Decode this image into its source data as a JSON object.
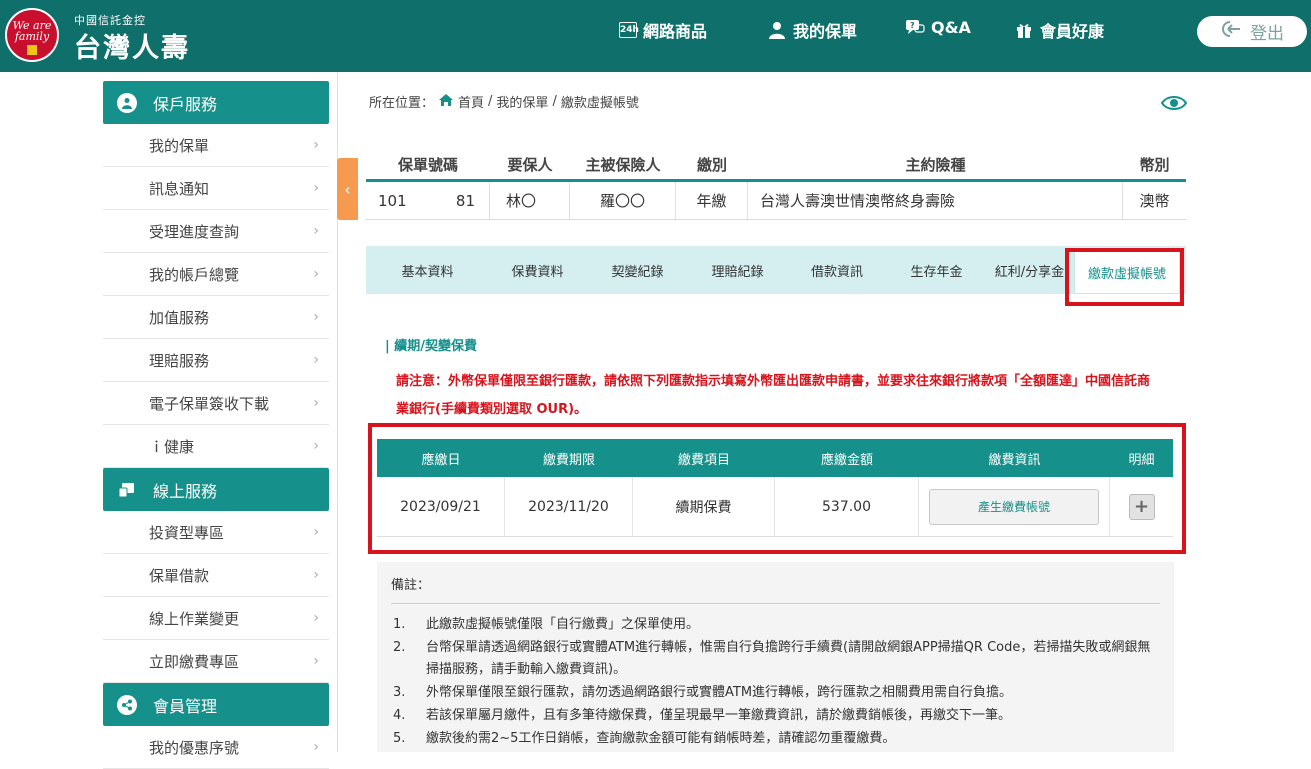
{
  "header": {
    "logo_text": "We are family",
    "brand_small": "中國信託金控",
    "brand_big": "台灣人壽",
    "nav": [
      {
        "icon": "24h-product-icon",
        "glyph": "24h",
        "label": "網路商品"
      },
      {
        "icon": "user-icon",
        "glyph": "👤",
        "label": "我的保單"
      },
      {
        "icon": "qa-icon",
        "glyph": "?",
        "label": "Q&A"
      },
      {
        "icon": "gift-icon",
        "glyph": "🎁",
        "label": "會員好康"
      }
    ],
    "logout_label": "登出"
  },
  "sidebar": {
    "sections": [
      {
        "title": "保戶服務",
        "icon": "user-icon",
        "items": [
          "我的保單",
          "訊息通知",
          "受理進度查詢",
          "我的帳戶總覽",
          "加值服務",
          "理賠服務",
          "電子保單簽收下載",
          "ｉ健康"
        ]
      },
      {
        "title": "線上服務",
        "icon": "online-service-icon",
        "items": [
          "投資型專區",
          "保單借款",
          "線上作業變更",
          "立即繳費專區"
        ]
      },
      {
        "title": "會員管理",
        "icon": "share-icon",
        "items": [
          "我的優惠序號"
        ]
      }
    ]
  },
  "breadcrumb": {
    "prefix": "所在位置：",
    "home": "首頁",
    "sep": "/",
    "level2": "我的保單",
    "level3": "繳款虛擬帳號"
  },
  "policy": {
    "headers": [
      "保單號碼",
      "要保人",
      "主被保險人",
      "繳別",
      "主約險種",
      "幣別"
    ],
    "row": {
      "policy_no_a": "101",
      "policy_no_b": "81",
      "applicant": "林〇",
      "insured": "羅〇〇",
      "pay_mode": "年繳",
      "product": "台灣人壽澳世情澳幣終身壽險",
      "currency": "澳幣"
    }
  },
  "tabs": [
    "基本資料",
    "保費資料",
    "契變紀錄",
    "理賠紀錄",
    "借款資訊",
    "生存年金",
    "紅利/分享金",
    "繳款虛擬帳號"
  ],
  "active_tab": "繳款虛擬帳號",
  "section_label": "| 續期/契變保費",
  "notice": "請注意：外幣保單僅限至銀行匯款，請依照下列匯款指示填寫外幣匯出匯款申請書，並要求往來銀行將款項「全額匯達」中國信託商業銀行(手續費類別選取 OUR)。",
  "payment": {
    "headers": [
      "應繳日",
      "繳費期限",
      "繳費項目",
      "應繳金額",
      "繳費資訊",
      "明細"
    ],
    "rows": [
      {
        "due_date": "2023/09/21",
        "deadline": "2023/11/20",
        "item": "續期保費",
        "amount": "537.00",
        "button": "產生繳費帳號",
        "detail": "+"
      }
    ]
  },
  "remarks": {
    "title": "備註：",
    "items": [
      {
        "num": "1.",
        "text": "此繳款虛擬帳號僅限「自行繳費」之保單使用。"
      },
      {
        "num": "2.",
        "text": "台幣保單請透過網路銀行或實體ATM進行轉帳，惟需自行負擔跨行手續費(請開啟網銀APP掃描QR Code，若掃描失敗或網銀無掃描服務，請手動輸入繳費資訊)。"
      },
      {
        "num": "3.",
        "text": "外幣保單僅限至銀行匯款，請勿透過網路銀行或實體ATM進行轉帳，跨行匯款之相關費用需自行負擔。"
      },
      {
        "num": "4.",
        "text": "若該保單屬月繳件，且有多筆待繳保費，僅呈現最早一筆繳費資訊，請於繳費銷帳後，再繳交下一筆。"
      },
      {
        "num": "5.",
        "text": "繳款後約需2~5工作日銷帳，查詢繳款金額可能有銷帳時差，請確認勿重覆繳費。"
      }
    ]
  },
  "colors": {
    "header_bg": "#0e6f6b",
    "accent": "#16908a",
    "tabs_bg": "#d5eff0",
    "highlight_red": "#d7141d",
    "collapse_orange": "#f59a4f"
  }
}
